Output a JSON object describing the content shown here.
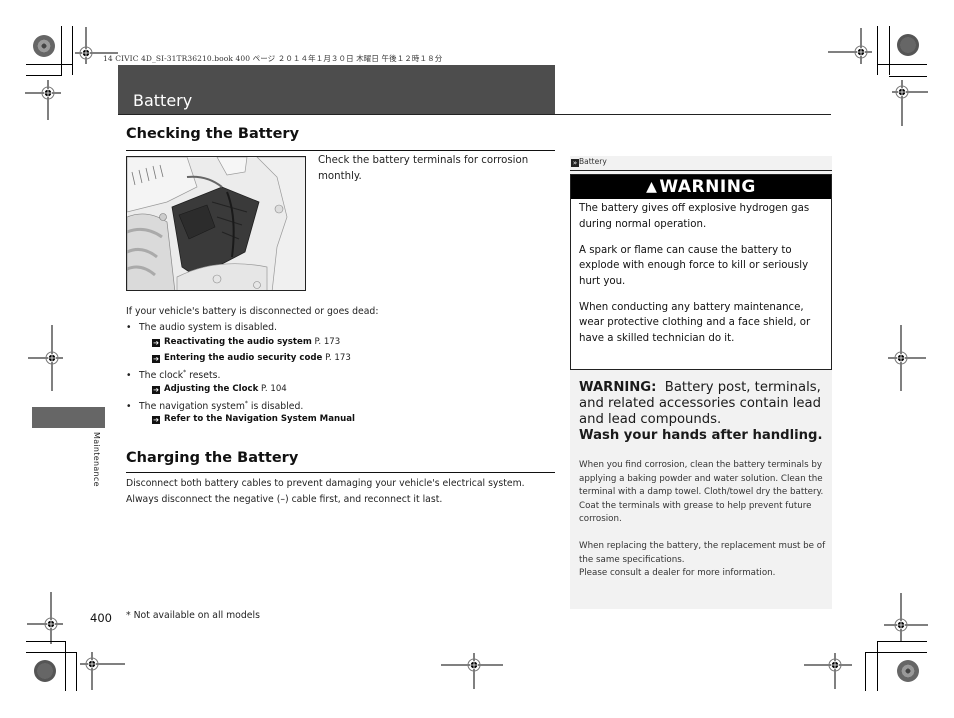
{
  "print_header": "14 CIVIC 4D_SI-31TR36210.book  400 ページ  ２０１４年１月３０日  木曜日  午後１２時１８分",
  "title": "Battery",
  "side_tab_label": "Maintenance",
  "checking": {
    "heading": "Checking the Battery",
    "image_alt": "battery-under-hood-illustration",
    "intro": "Check the battery terminals for corrosion monthly.",
    "lead": "If your vehicle's battery is disconnected or goes dead:",
    "bullets": [
      {
        "text": "The audio system is disabled.",
        "refs": [
          {
            "label": "Reactivating the audio system",
            "page": "P. 173"
          },
          {
            "label": "Entering the audio security code",
            "page": "P. 173"
          }
        ]
      },
      {
        "text_before": "The clock",
        "text_after": " resets.",
        "asterisk": "*",
        "refs": [
          {
            "label": "Adjusting the Clock",
            "page": "P. 104"
          }
        ]
      },
      {
        "text_before": "The navigation system",
        "text_after": " is disabled.",
        "asterisk": "*",
        "refs": [
          {
            "label": "Refer to the Navigation System Manual",
            "page": ""
          }
        ]
      }
    ]
  },
  "charging": {
    "heading": "Charging the Battery",
    "line1": "Disconnect both battery cables to prevent damaging your vehicle's electrical system.",
    "line2": "Always disconnect the negative (–) cable first, and reconnect it last."
  },
  "panel": {
    "crumb_icon": "double-chevron-icon",
    "crumb": "Battery",
    "warning_title": "WARNING",
    "warning_icon": "warning-triangle-icon",
    "warning_paragraphs": [
      "The battery gives off explosive hydrogen gas during normal operation.",
      "A spark or flame can cause the battery to explode with enough force to kill or seriously hurt you.",
      "When conducting any battery maintenance, wear protective clothing and a face shield, or have a skilled technician do it."
    ],
    "lead_warning_label": "WARNING:",
    "lead_warning_text": "Battery post, terminals, and related accessories contain lead and lead compounds.",
    "lead_warning_bold": "Wash your hands after handling.",
    "note1": "When you find corrosion, clean the battery terminals by applying a baking powder and water solution. Clean the terminal with a damp towel. Cloth/towel dry the battery. Coat the terminals with grease to help prevent future corrosion.",
    "note2a": "When replacing the battery, the replacement must be of the same specifications.",
    "note2b": "Please consult a dealer for more information."
  },
  "footer": {
    "page_number": "400",
    "footnote": "* Not available on all models"
  },
  "colors": {
    "title_bar": "#4d4d4d",
    "side_tab": "#666666",
    "panel_bg": "#f2f2f2",
    "warning_head": "#000000"
  }
}
